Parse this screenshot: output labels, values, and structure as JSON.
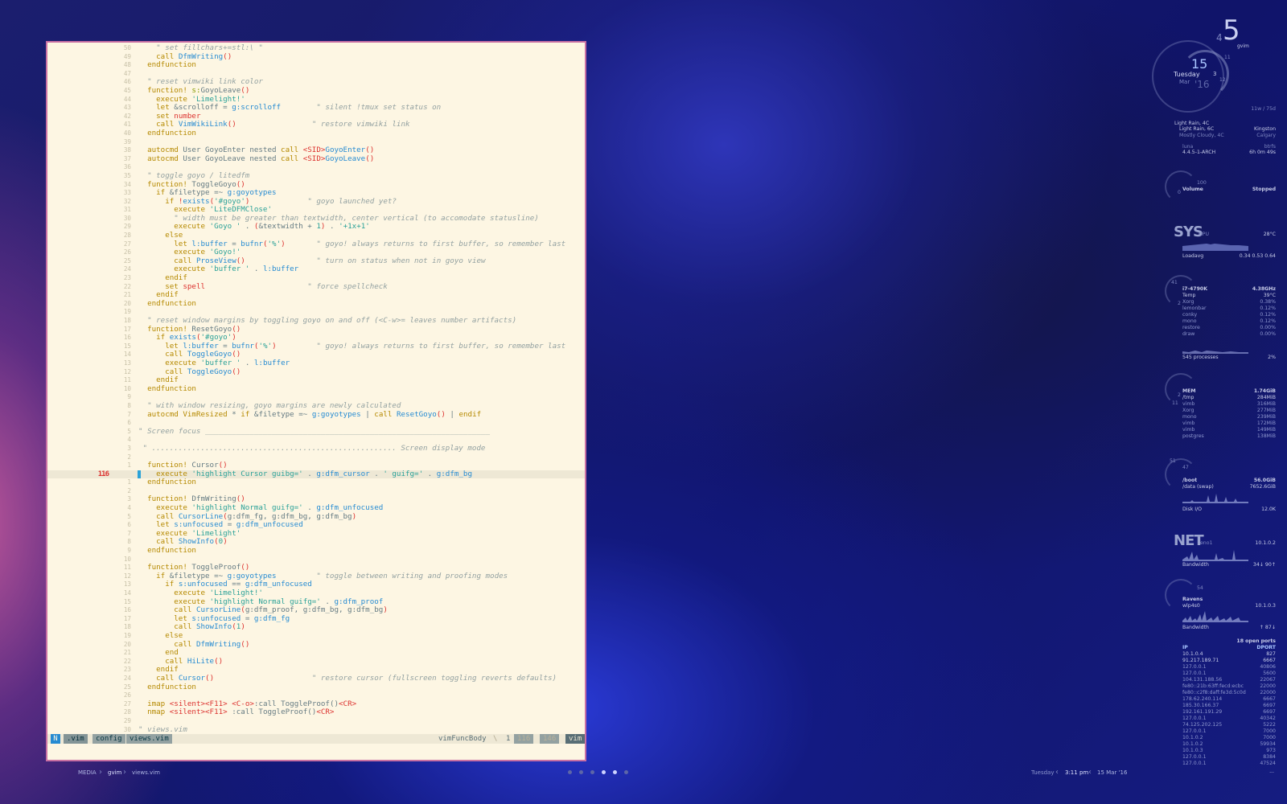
{
  "editor": {
    "lines": [
      {
        "n": "50",
        "t": "    <span class=\"cm\">\" set fillchars+=stl:\\ \"</span>"
      },
      {
        "n": "49",
        "t": "    <span class=\"kw\">call</span> <span class=\"fn\">DfmWriting</span><span class=\"sp\">()</span>"
      },
      {
        "n": "48",
        "t": "  <span class=\"kw\">endfunction</span>"
      },
      {
        "n": "47",
        "t": ""
      },
      {
        "n": "46",
        "t": "  <span class=\"cm\">\" reset vimwiki link color</span>"
      },
      {
        "n": "45",
        "t": "  <span class=\"kw\">function!</span> <span class=\"ok\">s:</span>GoyoLeave<span class=\"sp\">()</span>"
      },
      {
        "n": "44",
        "t": "    <span class=\"kw\">execute</span> <span class=\"str\">'Limelight!'</span>"
      },
      {
        "n": "43",
        "t": "    <span class=\"kw\">let</span> &amp;scrolloff = <span class=\"vr\">g:scrolloff</span>        <span class=\"cm\">\" silent !tmux set status on</span>"
      },
      {
        "n": "42",
        "t": "    <span class=\"kw\">set</span> <span class=\"sp\">number</span>"
      },
      {
        "n": "41",
        "t": "    <span class=\"kw\">call</span> <span class=\"fn\">VimWikiLink</span><span class=\"sp\">()</span>                 <span class=\"cm\">\" restore vimwiki link</span>"
      },
      {
        "n": "40",
        "t": "  <span class=\"kw\">endfunction</span>"
      },
      {
        "n": "39",
        "t": ""
      },
      {
        "n": "38",
        "t": "  <span class=\"kw\">autocmd</span> User GoyoEnter nested <span class=\"kw\">call</span> <span class=\"sp\">&lt;SID&gt;</span><span class=\"fn\">GoyoEnter</span><span class=\"sp\">()</span>"
      },
      {
        "n": "37",
        "t": "  <span class=\"kw\">autocmd</span> User GoyoLeave nested <span class=\"kw\">call</span> <span class=\"sp\">&lt;SID&gt;</span><span class=\"fn\">GoyoLeave</span><span class=\"sp\">()</span>"
      },
      {
        "n": "36",
        "t": ""
      },
      {
        "n": "35",
        "t": "  <span class=\"cm\">\" toggle goyo / litedfm</span>"
      },
      {
        "n": "34",
        "t": "  <span class=\"kw\">function!</span> ToggleGoyo<span class=\"sp\">()</span>"
      },
      {
        "n": "33",
        "t": "    <span class=\"kw\">if</span> &amp;filetype =~ <span class=\"vr\">g:goyotypes</span>"
      },
      {
        "n": "32",
        "t": "      <span class=\"kw\">if</span> <span class=\"sp\">!</span><span class=\"fn\">exists</span><span class=\"sp\">(</span><span class=\"str\">'#goyo'</span><span class=\"sp\">)</span>             <span class=\"cm\">\" goyo launched yet?</span>"
      },
      {
        "n": "31",
        "t": "        <span class=\"kw\">execute</span> <span class=\"str\">'LiteDFMClose'</span>"
      },
      {
        "n": "30",
        "t": "        <span class=\"cm\">\" width must be greater than textwidth, center vertical (to accomodate statusline)</span>"
      },
      {
        "n": "29",
        "t": "        <span class=\"kw\">execute</span> <span class=\"str\">'Goyo '</span> . <span class=\"sp\">(</span>&amp;textwidth + <span class=\"str\">1</span><span class=\"sp\">)</span> . <span class=\"str\">'+1x+1'</span>"
      },
      {
        "n": "28",
        "t": "      <span class=\"kw\">else</span>"
      },
      {
        "n": "27",
        "t": "        <span class=\"kw\">let</span> <span class=\"vr\">l:buffer</span> = <span class=\"fn\">bufnr</span><span class=\"sp\">(</span><span class=\"str\">'%'</span><span class=\"sp\">)</span>       <span class=\"cm\">\" goyo! always returns to first buffer, so remember last</span>"
      },
      {
        "n": "26",
        "t": "        <span class=\"kw\">execute</span> <span class=\"str\">'Goyo!'</span>"
      },
      {
        "n": "25",
        "t": "        <span class=\"kw\">call</span> <span class=\"fn\">ProseView</span><span class=\"sp\">()</span>                <span class=\"cm\">\" turn on status when not in goyo view</span>"
      },
      {
        "n": "24",
        "t": "        <span class=\"kw\">execute</span> <span class=\"str\">'buffer '</span> . <span class=\"vr\">l:buffer</span>"
      },
      {
        "n": "23",
        "t": "      <span class=\"kw\">endif</span>"
      },
      {
        "n": "22",
        "t": "      <span class=\"kw\">set</span> <span class=\"sp\">spell</span>                       <span class=\"cm\">\" force spellcheck</span>"
      },
      {
        "n": "21",
        "t": "    <span class=\"kw\">endif</span>"
      },
      {
        "n": "20",
        "t": "  <span class=\"kw\">endfunction</span>"
      },
      {
        "n": "19",
        "t": ""
      },
      {
        "n": "18",
        "t": "  <span class=\"cm\">\" reset window margins by toggling goyo on and off (&lt;C-w&gt;= leaves number artifacts)</span>"
      },
      {
        "n": "17",
        "t": "  <span class=\"kw\">function!</span> ResetGoyo<span class=\"sp\">()</span>"
      },
      {
        "n": "16",
        "t": "    <span class=\"kw\">if</span> <span class=\"fn\">exists</span><span class=\"sp\">(</span><span class=\"str\">'#goyo'</span><span class=\"sp\">)</span>"
      },
      {
        "n": "15",
        "t": "      <span class=\"kw\">let</span> <span class=\"vr\">l:buffer</span> = <span class=\"fn\">bufnr</span><span class=\"sp\">(</span><span class=\"str\">'%'</span><span class=\"sp\">)</span>         <span class=\"cm\">\" goyo! always returns to first buffer, so remember last</span>"
      },
      {
        "n": "14",
        "t": "      <span class=\"kw\">call</span> <span class=\"fn\">ToggleGoyo</span><span class=\"sp\">()</span>"
      },
      {
        "n": "13",
        "t": "      <span class=\"kw\">execute</span> <span class=\"str\">'buffer '</span> . <span class=\"vr\">l:buffer</span>"
      },
      {
        "n": "12",
        "t": "      <span class=\"kw\">call</span> <span class=\"fn\">ToggleGoyo</span><span class=\"sp\">()</span>"
      },
      {
        "n": "11",
        "t": "    <span class=\"kw\">endif</span>"
      },
      {
        "n": "10",
        "t": "  <span class=\"kw\">endfunction</span>"
      },
      {
        "n": "9",
        "t": ""
      },
      {
        "n": "8",
        "t": "  <span class=\"cm\">\" with window resizing, goyo margins are newly calculated</span>"
      },
      {
        "n": "7",
        "t": "  <span class=\"kw\">autocmd</span> <span class=\"kw\">VimResized</span> * <span class=\"kw\">if</span> &amp;filetype =~ <span class=\"vr\">g:goyotypes</span> | <span class=\"kw\">call</span> <span class=\"fn\">ResetGoyo</span><span class=\"sp\">()</span> | <span class=\"kw\">endif</span>"
      },
      {
        "n": "6",
        "t": ""
      },
      {
        "n": "5",
        "t": "<span class=\"cm\">\" Screen focus ________________________________________________________________</span>"
      },
      {
        "n": "4",
        "t": ""
      },
      {
        "n": "3",
        "t": " <span class=\"cm\">\" ....................................................... Screen display mode</span>"
      },
      {
        "n": "2",
        "t": ""
      },
      {
        "n": "1",
        "t": "  <span class=\"kw\">function!</span> Cursor<span class=\"sp\">()</span>"
      },
      {
        "n": "116",
        "cur": true,
        "t": "    <span class=\"kw\">execute</span> <span class=\"str\">'highlight Cursor guibg='</span> . <span class=\"vr\">g:dfm_cursor</span> . <span class=\"str\">' guifg='</span> . <span class=\"vr\">g:dfm_bg</span>"
      },
      {
        "n": "1",
        "t": "  <span class=\"kw\">endfunction</span>"
      },
      {
        "n": "2",
        "t": ""
      },
      {
        "n": "3",
        "t": "  <span class=\"kw\">function!</span> DfmWriting<span class=\"sp\">()</span>"
      },
      {
        "n": "4",
        "t": "    <span class=\"kw\">execute</span> <span class=\"str\">'highlight Normal guifg='</span> . <span class=\"vr\">g:dfm_unfocused</span>"
      },
      {
        "n": "5",
        "t": "    <span class=\"kw\">call</span> <span class=\"fn\">CursorLine</span><span class=\"sp\">(</span>g:dfm_fg, g:dfm_bg, g:dfm_bg<span class=\"sp\">)</span>"
      },
      {
        "n": "6",
        "t": "    <span class=\"kw\">let</span> <span class=\"vr\">s:unfocused</span> = <span class=\"vr\">g:dfm_unfocused</span>"
      },
      {
        "n": "7",
        "t": "    <span class=\"kw\">execute</span> <span class=\"str\">'Limelight'</span>"
      },
      {
        "n": "8",
        "t": "    <span class=\"kw\">call</span> <span class=\"fn\">ShowInfo</span><span class=\"sp\">(</span><span class=\"str\">0</span><span class=\"sp\">)</span>"
      },
      {
        "n": "9",
        "t": "  <span class=\"kw\">endfunction</span>"
      },
      {
        "n": "10",
        "t": ""
      },
      {
        "n": "11",
        "t": "  <span class=\"kw\">function!</span> ToggleProof<span class=\"sp\">()</span>"
      },
      {
        "n": "12",
        "t": "    <span class=\"kw\">if</span> &amp;filetype =~ <span class=\"vr\">g:goyotypes</span>         <span class=\"cm\">\" toggle between writing and proofing modes</span>"
      },
      {
        "n": "13",
        "t": "      <span class=\"kw\">if</span> <span class=\"vr\">s:unfocused</span> == <span class=\"vr\">g:dfm_unfocused</span>"
      },
      {
        "n": "14",
        "t": "        <span class=\"kw\">execute</span> <span class=\"str\">'Limelight!'</span>"
      },
      {
        "n": "15",
        "t": "        <span class=\"kw\">execute</span> <span class=\"str\">'highlight Normal guifg='</span> . <span class=\"vr\">g:dfm_proof</span>"
      },
      {
        "n": "16",
        "t": "        <span class=\"kw\">call</span> <span class=\"fn\">CursorLine</span><span class=\"sp\">(</span>g:dfm_proof, g:dfm_bg, g:dfm_bg<span class=\"sp\">)</span>"
      },
      {
        "n": "17",
        "t": "        <span class=\"kw\">let</span> <span class=\"vr\">s:unfocused</span> = <span class=\"vr\">g:dfm_fg</span>"
      },
      {
        "n": "18",
        "t": "        <span class=\"kw\">call</span> <span class=\"fn\">ShowInfo</span><span class=\"sp\">(</span><span class=\"str\">1</span><span class=\"sp\">)</span>"
      },
      {
        "n": "19",
        "t": "      <span class=\"kw\">else</span>"
      },
      {
        "n": "20",
        "t": "        <span class=\"kw\">call</span> <span class=\"fn\">DfmWriting</span><span class=\"sp\">()</span>"
      },
      {
        "n": "21",
        "t": "      <span class=\"kw\">end</span>"
      },
      {
        "n": "22",
        "t": "      <span class=\"kw\">call</span> <span class=\"fn\">HiLite</span><span class=\"sp\">()</span>"
      },
      {
        "n": "23",
        "t": "    <span class=\"kw\">endif</span>"
      },
      {
        "n": "24",
        "t": "    <span class=\"kw\">call</span> <span class=\"fn\">Cursor</span><span class=\"sp\">()</span>                      <span class=\"cm\">\" restore cursor (fullscreen toggling reverts defaults)</span>"
      },
      {
        "n": "25",
        "t": "  <span class=\"kw\">endfunction</span>"
      },
      {
        "n": "26",
        "t": ""
      },
      {
        "n": "27",
        "t": "  <span class=\"kw\">imap</span> <span class=\"sp\">&lt;silent&gt;&lt;F11&gt;</span> <span class=\"sp\">&lt;C-o&gt;</span>:call ToggleProof()<span class=\"sp\">&lt;CR&gt;</span>"
      },
      {
        "n": "28",
        "t": "  <span class=\"kw\">nmap</span> <span class=\"sp\">&lt;silent&gt;&lt;F11&gt;</span> :call ToggleProof()<span class=\"sp\">&lt;CR&gt;</span>"
      },
      {
        "n": "29",
        "t": ""
      },
      {
        "n": "30",
        "t": "<span class=\"cm\">\" views.vim</span>"
      }
    ],
    "status": {
      "mode": "N",
      "path1": ".vim",
      "path2": "config",
      "file": "views.vim",
      "func": "vimFuncBody",
      "col": "1",
      "line": "116",
      "total": "146",
      "ft": "vim"
    }
  },
  "conky": {
    "workspace_num": "5",
    "workspace_prev": "4",
    "workspace_name": "gvim",
    "day": "15",
    "weekday": "Tuesday",
    "month": "Mar",
    "year": "'16",
    "ring_hour": "3",
    "ring_min": "11",
    "ring_sec": "12",
    "uptime": "11w / 75d",
    "weather1": "Light Rain, 4C",
    "weather2": "Light Rain, 6C",
    "weather2_city": "Kingston",
    "weather3": "Mostly Cloudy, 4C",
    "weather3_city": "Calgary",
    "host": "luna",
    "fs": "btrfs",
    "kernel": "4.4.5-1-ARCH",
    "uptime2": "6h 0m 49s",
    "vol_max": "100",
    "vol_min": "0",
    "volume_label": "Volume",
    "volume_state": "Stopped",
    "sys_label": "SYS",
    "gpu_label": "GPU",
    "gpu_temp": "28°C",
    "loadavg_label": "Loadavg",
    "loadavg": "0.34  0.53  0.64",
    "cpu_ring_a": "41",
    "cpu_ring_b": "2",
    "cpu_rows": [
      {
        "k": "i7-4790K",
        "v": "4.38GHz"
      },
      {
        "k": "Temp",
        "v": "39°C"
      },
      {
        "k": "Xorg",
        "v": "0.38%"
      },
      {
        "k": "lemonbar",
        "v": "0.12%"
      },
      {
        "k": "conky",
        "v": "0.12%"
      },
      {
        "k": "mono",
        "v": "0.12%"
      },
      {
        "k": "restore",
        "v": "0.00%"
      },
      {
        "k": "draw",
        "v": "0.00%"
      }
    ],
    "processes_label": "545 processes",
    "processes_val": "2%",
    "mem_ring_a": "2",
    "mem_ring_b": "11",
    "mem_rows": [
      {
        "k": "MEM",
        "v": "1.74GiB"
      },
      {
        "k": "/tmp",
        "v": "284MiB"
      },
      {
        "k": "vimb",
        "v": "316MiB"
      },
      {
        "k": "Xorg",
        "v": "277MiB"
      },
      {
        "k": "mono",
        "v": "239MiB"
      },
      {
        "k": "vimb",
        "v": "172MiB"
      },
      {
        "k": "vimb",
        "v": "149MiB"
      },
      {
        "k": "postgres",
        "v": "138MiB"
      }
    ],
    "disk_ring_a": "51",
    "disk_ring_b": "47",
    "disk_rows": [
      {
        "k": "/boot",
        "v": "56.0GiB"
      },
      {
        "k": "/data  (swap)",
        "v": "7652.6GiB"
      }
    ],
    "diskio_label": "Disk I/O",
    "diskio_val": "12.0K",
    "net_label": "NET",
    "net_iface": "eno1",
    "net_ip": "10.1.0.2",
    "bandwidth_label": "Bandwidth",
    "bandwidth_val": "34↓ 90↑",
    "wifi_ring": "54",
    "wifi_ssid": "Ravens",
    "wifi_iface": "wlp4s0",
    "wifi_ip": "10.1.0.3",
    "bandwidth2_val": "↑ 87↓",
    "ports_label": "18 open ports",
    "ports_h_ip": "IP",
    "ports_h_port": "DPORT",
    "ports": [
      {
        "ip": "10.1.0.4",
        "p": "827"
      },
      {
        "ip": "91.217.189.71",
        "p": "6667"
      },
      {
        "ip": "127.0.0.1",
        "p": "40806"
      },
      {
        "ip": "127.0.0.1",
        "p": "5600"
      },
      {
        "ip": "104.131.188.56",
        "p": "22067"
      },
      {
        "ip": "fe80::21b:63ff:fecd:ecbc",
        "p": "22000"
      },
      {
        "ip": "fe80::c2f8:daff:fe3d:5c0d",
        "p": "22000"
      },
      {
        "ip": "178.62.240.114",
        "p": "6667"
      },
      {
        "ip": "185.30.166.37",
        "p": "6697"
      },
      {
        "ip": "192.161.191.29",
        "p": "6697"
      },
      {
        "ip": "127.0.0.1",
        "p": "40342"
      },
      {
        "ip": "74.125.202.125",
        "p": "5222"
      },
      {
        "ip": "127.0.0.1",
        "p": "7000"
      },
      {
        "ip": "10.1.0.2",
        "p": "7000"
      },
      {
        "ip": "10.1.0.2",
        "p": "59934"
      },
      {
        "ip": "10.1.0.3",
        "p": "973"
      },
      {
        "ip": "127.0.0.1",
        "p": "8384"
      },
      {
        "ip": "127.0.0.1",
        "p": "47524"
      }
    ],
    "ports_more": "..."
  },
  "bar": {
    "crumb1": "MEDIA",
    "crumb2": "gvim",
    "crumb3": "views.vim",
    "date_day": "Tuesday",
    "time": "3:11 pm",
    "date": "15 Mar '16",
    "workspaces": [
      false,
      false,
      false,
      true,
      true,
      false
    ],
    "sep_icon": "chevron-right-icon"
  },
  "colors": {
    "accent": "#268bd2",
    "bg": "#fdf6e3",
    "border": "#c970a3"
  }
}
